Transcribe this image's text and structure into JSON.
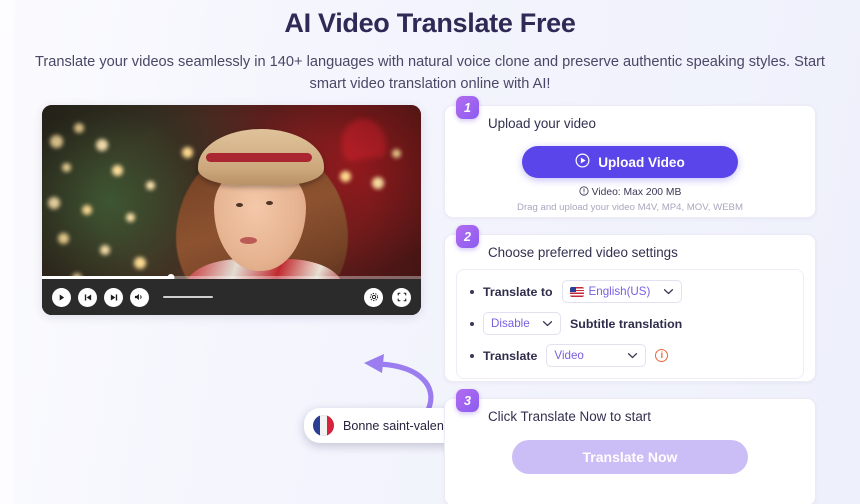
{
  "hero": {
    "title": "AI Video Translate Free",
    "subtitle": "Translate your videos seamlessly in 140+ languages with natural voice clone and preserve authentic speaking styles. Start smart video translation online with AI!"
  },
  "player": {
    "play_icon": "play-icon",
    "prev_icon": "skip-back-icon",
    "next_icon": "skip-forward-icon",
    "volume_icon": "volume-icon",
    "progress_percent": 34
  },
  "subtitle_tooltip": {
    "flag": "flag-fr-icon",
    "text": "Bonne saint-valentin."
  },
  "steps": [
    {
      "number": "1",
      "title": "Upload your video",
      "button_label": "Upload Video",
      "button_icon": "play-circle-icon",
      "note_icon": "info-circle-icon",
      "note_primary": "Video: Max 200 MB",
      "note_secondary": "Drag and upload your video M4V, MP4, MOV, WEBM",
      "accent": "#5a45ea"
    },
    {
      "number": "2",
      "title": "Choose preferred video settings",
      "settings": [
        {
          "label": "Translate to",
          "label_position": "before",
          "select_value": "English(US)",
          "select_icon": "flag-us-icon",
          "caret": "chevron-down-icon"
        },
        {
          "label": "Subtitle translation",
          "label_position": "after",
          "select_value": "Disable",
          "caret": "chevron-down-icon"
        },
        {
          "label": "Translate",
          "label_position": "before",
          "select_value": "Video",
          "caret": "chevron-down-icon",
          "info_icon": "info-circle-icon",
          "info_glyph": "i"
        }
      ]
    },
    {
      "number": "3",
      "title": "Click Translate Now to start",
      "button_label": "Translate Now",
      "button_disabled": true,
      "button_color": "#cbbdf5"
    }
  ],
  "colors": {
    "heading": "#2e2a55",
    "page_bg": "#f2f3fb",
    "primary": "#5a45ea",
    "badge_gradient_start": "#b36cf0",
    "badge_gradient_end": "#8b5cf0",
    "select_text": "#7a5fe0",
    "arrow": "#9b7df0"
  }
}
